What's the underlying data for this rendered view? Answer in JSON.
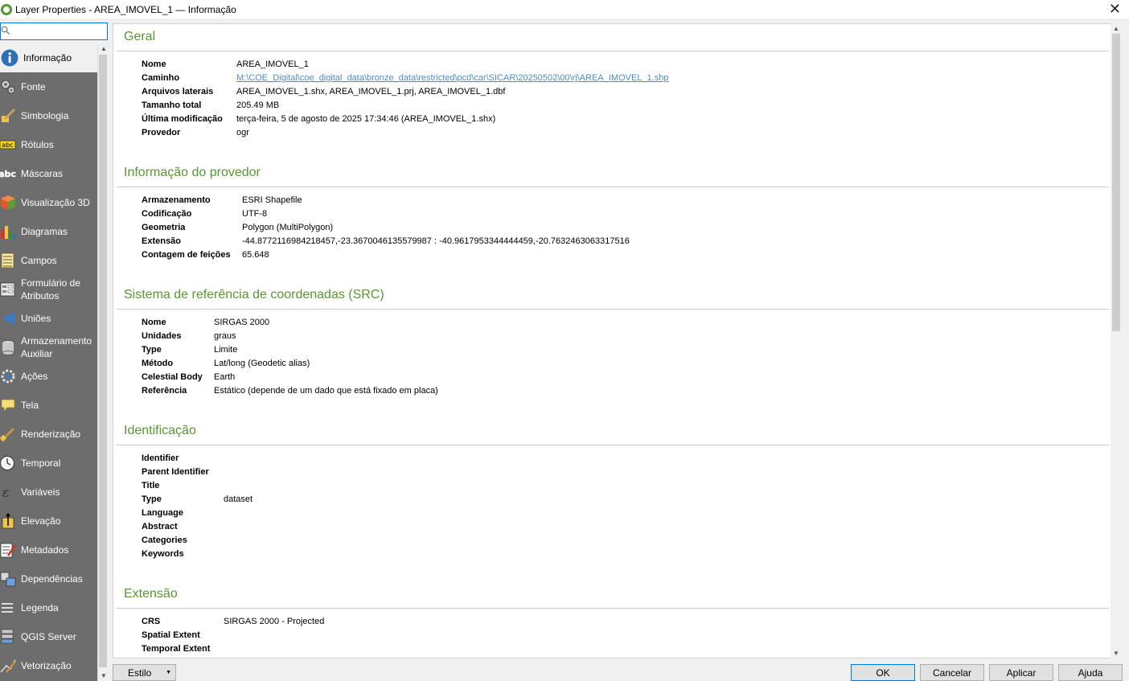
{
  "window": {
    "title": "Layer Properties - AREA_IMOVEL_1 — Informação",
    "close_glyph": "✕"
  },
  "search": {
    "value": "",
    "placeholder": ""
  },
  "sidebar": {
    "items": [
      {
        "label": "Informação",
        "icon": "info-icon"
      },
      {
        "label": "Fonte",
        "icon": "source-icon"
      },
      {
        "label": "Simbologia",
        "icon": "symbology-icon"
      },
      {
        "label": "Rótulos",
        "icon": "labels-icon"
      },
      {
        "label": "Máscaras",
        "icon": "masks-icon"
      },
      {
        "label": "Visualização 3D",
        "icon": "view-3d-icon"
      },
      {
        "label": "Diagramas",
        "icon": "diagrams-icon"
      },
      {
        "label": "Campos",
        "icon": "fields-icon"
      },
      {
        "label": "Formulário de Atributos",
        "icon": "attributes-form-icon"
      },
      {
        "label": "Uniões",
        "icon": "joins-icon"
      },
      {
        "label": "Armazenamento Auxiliar",
        "icon": "auxiliary-storage-icon"
      },
      {
        "label": "Ações",
        "icon": "actions-icon"
      },
      {
        "label": "Tela",
        "icon": "display-icon"
      },
      {
        "label": "Renderização",
        "icon": "rendering-icon"
      },
      {
        "label": "Temporal",
        "icon": "temporal-icon"
      },
      {
        "label": "Variáveis",
        "icon": "variables-icon"
      },
      {
        "label": "Elevação",
        "icon": "elevation-icon"
      },
      {
        "label": "Metadados",
        "icon": "metadata-icon"
      },
      {
        "label": "Dependências",
        "icon": "dependencies-icon"
      },
      {
        "label": "Legenda",
        "icon": "legend-icon"
      },
      {
        "label": "QGIS Server",
        "icon": "qgis-server-icon"
      },
      {
        "label": "Vetorização",
        "icon": "digitizing-icon"
      }
    ]
  },
  "sections": {
    "geral": {
      "title": "Geral",
      "rows": [
        {
          "k": "Nome",
          "v": "AREA_IMOVEL_1"
        },
        {
          "k": "Caminho",
          "v": "M:\\COE_Digital\\coe_digital_data\\bronze_data\\restricted\\pcd\\car\\SICAR\\20250502\\00\\rj\\AREA_IMOVEL_1.shp"
        },
        {
          "k": "Arquivos laterais",
          "v": "AREA_IMOVEL_1.shx, AREA_IMOVEL_1.prj, AREA_IMOVEL_1.dbf"
        },
        {
          "k": "Tamanho total",
          "v": "205.49 MB"
        },
        {
          "k": "Última modificação",
          "v": "terça-feira, 5 de agosto de 2025 17:34:46 (AREA_IMOVEL_1.shx)"
        },
        {
          "k": "Provedor",
          "v": "ogr"
        }
      ]
    },
    "provedor": {
      "title": "Informação do provedor",
      "rows": [
        {
          "k": "Armazenamento",
          "v": "ESRI Shapefile"
        },
        {
          "k": "Codificação",
          "v": "UTF-8"
        },
        {
          "k": "Geometria",
          "v": "Polygon (MultiPolygon)"
        },
        {
          "k": "Extensão",
          "v": "-44.8772116984218457,-23.3670046135579987 : -40.9617953344444459,-20.7632463063317516"
        },
        {
          "k": "Contagem de feições",
          "v": "65.648"
        }
      ]
    },
    "src": {
      "title": "Sistema de referência de coordenadas (SRC)",
      "rows": [
        {
          "k": "Nome",
          "v": "SIRGAS 2000"
        },
        {
          "k": "Unidades",
          "v": "graus"
        },
        {
          "k": "Type",
          "v": "Limite"
        },
        {
          "k": "Método",
          "v": "Lat/long (Geodetic alias)"
        },
        {
          "k": "Celestial Body",
          "v": "Earth"
        },
        {
          "k": "Referência",
          "v": "Estático (depende de um dado que está fixado em placa)"
        }
      ]
    },
    "identificacao": {
      "title": "Identificação",
      "rows": [
        {
          "k": "Identifier",
          "v": ""
        },
        {
          "k": "Parent Identifier",
          "v": ""
        },
        {
          "k": "Title",
          "v": ""
        },
        {
          "k": "Type",
          "v": "dataset"
        },
        {
          "k": "Language",
          "v": ""
        },
        {
          "k": "Abstract",
          "v": ""
        },
        {
          "k": "Categories",
          "v": ""
        },
        {
          "k": "Keywords",
          "v": ""
        }
      ]
    },
    "extensao": {
      "title": "Extensão",
      "rows": [
        {
          "k": "CRS",
          "v": "SIRGAS 2000 - Projected"
        },
        {
          "k": "Spatial Extent",
          "v": ""
        },
        {
          "k": "Temporal Extent",
          "v": ""
        }
      ]
    }
  },
  "footer": {
    "style_label": "Estilo",
    "ok_label": "OK",
    "cancel_label": "Cancelar",
    "apply_label": "Aplicar",
    "help_label": "Ajuda"
  },
  "colors": {
    "section_title": "#589632",
    "link": "#4a8fc7",
    "sidebar_bg": "#6d6d6d",
    "focus": "#0078d7"
  }
}
